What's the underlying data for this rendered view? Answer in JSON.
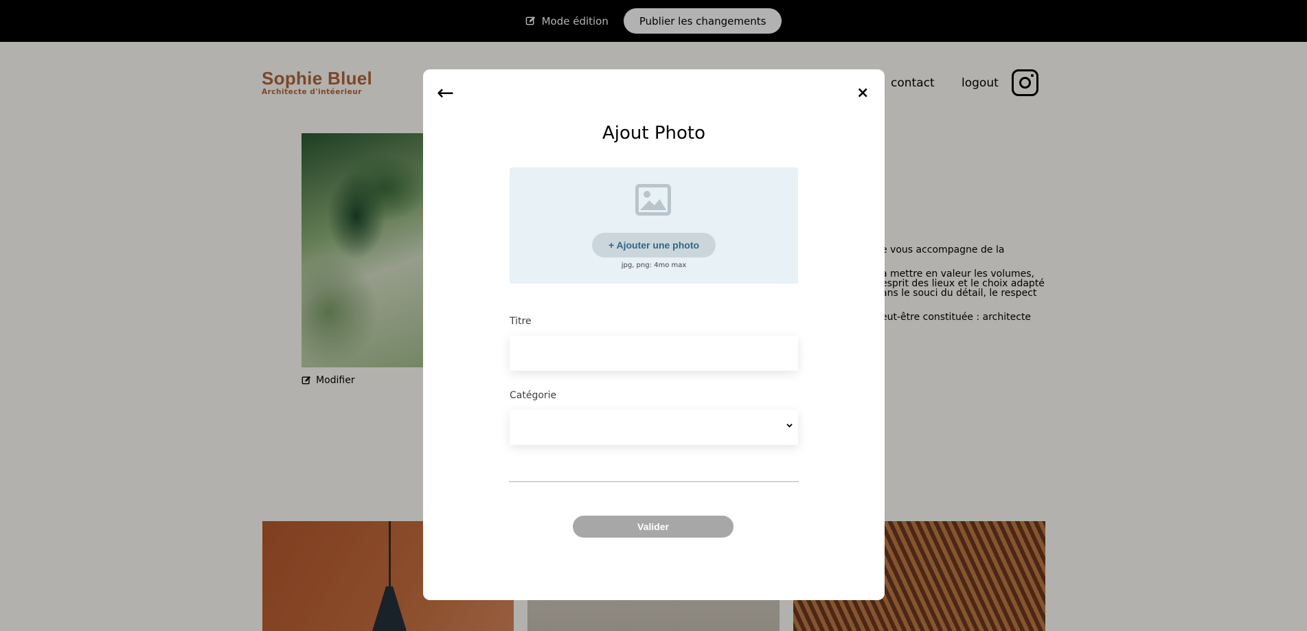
{
  "edit_bar": {
    "mode_label": "Mode édition",
    "publish_label": "Publier les changements"
  },
  "header": {
    "logo_name": "Sophie Bluel",
    "logo_subtitle": "Architecte d'intéerieur",
    "nav": [
      "contact",
      "logout"
    ]
  },
  "intro": {
    "modify_label": "Modifier",
    "paragraphs": [
      "e vous accompagne de la",
      "à mettre en valeur les volumes, esprit des lieux et le choix adapté ans le souci du détail, le respect",
      "eut-être constituée : architecte"
    ]
  },
  "modal": {
    "back_icon": "←",
    "close_icon": "×",
    "title": "Ajout Photo",
    "dropzone": {
      "add_button": "+ Ajouter une photo",
      "hint": "jpg, png: 4mo max"
    },
    "title_label": "Titre",
    "title_value": "",
    "category_label": "Catégorie",
    "category_value": "",
    "submit_label": "Valider"
  },
  "colors": {
    "brand": "#b1663c",
    "dropzone_bg": "#e8f1f6",
    "add_button_text": "#306685",
    "submit_disabled": "#a7a7a7"
  }
}
